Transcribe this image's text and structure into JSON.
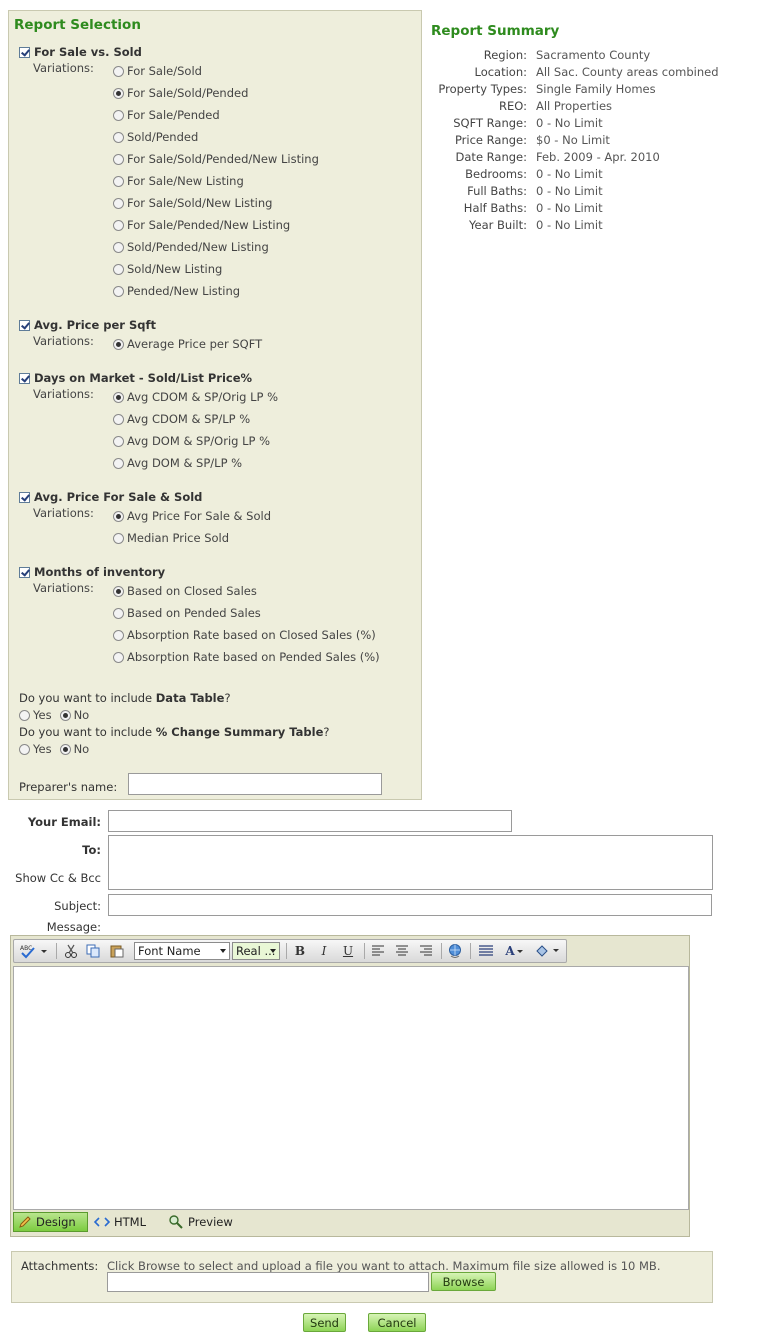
{
  "selection": {
    "title": "Report Selection",
    "variations_label": "Variations:",
    "sections": [
      {
        "title": "For Sale vs. Sold",
        "checked": true,
        "options": [
          {
            "label": "For Sale/Sold",
            "selected": false
          },
          {
            "label": "For Sale/Sold/Pended",
            "selected": true
          },
          {
            "label": "For Sale/Pended",
            "selected": false
          },
          {
            "label": "Sold/Pended",
            "selected": false
          },
          {
            "label": "For Sale/Sold/Pended/New Listing",
            "selected": false
          },
          {
            "label": "For Sale/New Listing",
            "selected": false
          },
          {
            "label": "For Sale/Sold/New Listing",
            "selected": false
          },
          {
            "label": "For Sale/Pended/New Listing",
            "selected": false
          },
          {
            "label": "Sold/Pended/New Listing",
            "selected": false
          },
          {
            "label": "Sold/New Listing",
            "selected": false
          },
          {
            "label": "Pended/New Listing",
            "selected": false
          }
        ]
      },
      {
        "title": "Avg. Price per Sqft",
        "checked": true,
        "options": [
          {
            "label": "Average Price per SQFT",
            "selected": true
          }
        ]
      },
      {
        "title": "Days on Market - Sold/List Price%",
        "checked": true,
        "options": [
          {
            "label": "Avg CDOM & SP/Orig LP %",
            "selected": true
          },
          {
            "label": "Avg CDOM & SP/LP %",
            "selected": false
          },
          {
            "label": "Avg DOM & SP/Orig LP %",
            "selected": false
          },
          {
            "label": "Avg DOM & SP/LP %",
            "selected": false
          }
        ]
      },
      {
        "title": "Avg. Price For Sale & Sold",
        "checked": true,
        "options": [
          {
            "label": "Avg Price For Sale & Sold",
            "selected": true
          },
          {
            "label": "Median Price Sold",
            "selected": false
          }
        ]
      },
      {
        "title": "Months of inventory",
        "checked": true,
        "options": [
          {
            "label": "Based on Closed Sales",
            "selected": true
          },
          {
            "label": "Based on Pended Sales",
            "selected": false
          },
          {
            "label": "Absorption Rate based on Closed Sales (%)",
            "selected": false
          },
          {
            "label": "Absorption Rate based on Pended Sales (%)",
            "selected": false
          }
        ]
      }
    ],
    "q_data_table": {
      "prefix": "Do you want to include ",
      "bold": "Data Table",
      "suffix": "?",
      "yes": "Yes",
      "no": "No",
      "selected": "No"
    },
    "q_change_table": {
      "prefix": "Do you want to include ",
      "bold": "% Change Summary Table",
      "suffix": "?",
      "yes": "Yes",
      "no": "No",
      "selected": "No"
    },
    "preparer_label": "Preparer's name:",
    "preparer_value": ""
  },
  "summary": {
    "title": "Report Summary",
    "rows": [
      {
        "key": "Region:",
        "value": "Sacramento County"
      },
      {
        "key": "Location:",
        "value": "All Sac. County areas combined"
      },
      {
        "key": "Property Types:",
        "value": "Single Family Homes"
      },
      {
        "key": "REO:",
        "value": "All Properties"
      },
      {
        "key": "SQFT Range:",
        "value": "0 - No Limit"
      },
      {
        "key": "Price Range:",
        "value": "$0 - No Limit"
      },
      {
        "key": "Date Range:",
        "value": "Feb. 2009 - Apr. 2010"
      },
      {
        "key": "Bedrooms:",
        "value": "0 - No Limit"
      },
      {
        "key": "Full Baths:",
        "value": "0 - No Limit"
      },
      {
        "key": "Half Baths:",
        "value": "0 - No Limit"
      },
      {
        "key": "Year Built:",
        "value": "0 - No Limit"
      }
    ]
  },
  "email": {
    "your_email_label": "Your Email:",
    "your_email_value": "",
    "to_label": "To:",
    "to_value": "",
    "cc_bcc_link": "Show Cc & Bcc",
    "subject_label": "Subject:",
    "subject_value": "",
    "message_label": "Message:"
  },
  "editor": {
    "font_name": "Font Name",
    "font_size": "Real ...",
    "bold": "B",
    "italic": "I",
    "underline": "U",
    "font_color_letter": "A",
    "tabs": {
      "design": "Design",
      "html": "HTML",
      "preview": "Preview"
    },
    "active_tab": "Design"
  },
  "attachments": {
    "label": "Attachments:",
    "help": "Click Browse to select and upload a file you want to attach. Maximum file size allowed is 10 MB.",
    "browse": "Browse",
    "file_value": ""
  },
  "actions": {
    "send": "Send",
    "cancel": "Cancel"
  },
  "colors": {
    "title_green": "#2e8b1e",
    "panel_bg": "#eeeedc",
    "button_green": "#8ed456"
  }
}
